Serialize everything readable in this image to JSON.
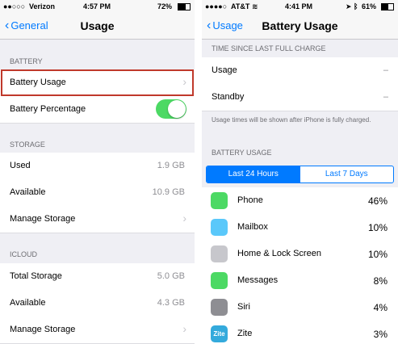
{
  "left": {
    "status": {
      "carrier": "Verizon",
      "time": "4:57 PM",
      "battery": "72%"
    },
    "nav": {
      "back": "General",
      "title": "Usage"
    },
    "battery_header": "BATTERY",
    "battery_usage": "Battery Usage",
    "battery_percentage": "Battery Percentage",
    "storage_header": "STORAGE",
    "used": {
      "label": "Used",
      "value": "1.9 GB"
    },
    "available": {
      "label": "Available",
      "value": "10.9 GB"
    },
    "manage": "Manage Storage",
    "icloud_header": "ICLOUD",
    "total": {
      "label": "Total Storage",
      "value": "5.0 GB"
    },
    "icloud_available": {
      "label": "Available",
      "value": "4.3 GB"
    },
    "icloud_manage": "Manage Storage"
  },
  "right": {
    "status": {
      "carrier": "AT&T",
      "time": "4:41 PM",
      "battery": "61%"
    },
    "nav": {
      "back": "Usage",
      "title": "Battery Usage"
    },
    "since_header": "TIME SINCE LAST FULL CHARGE",
    "usage": {
      "label": "Usage",
      "value": "–"
    },
    "standby": {
      "label": "Standby",
      "value": "–"
    },
    "note": "Usage times will be shown after iPhone is fully charged.",
    "battery_usage_header": "BATTERY USAGE",
    "segments": [
      "Last 24 Hours",
      "Last 7 Days"
    ],
    "apps": [
      {
        "name": "Phone",
        "pct": "46%",
        "color": "#4cd964",
        "icon": "phone-icon"
      },
      {
        "name": "Mailbox",
        "pct": "10%",
        "color": "#5ac8fa",
        "icon": "mailbox-icon"
      },
      {
        "name": "Home & Lock Screen",
        "pct": "10%",
        "color": "#c7c7cc",
        "icon": "home-lock-icon"
      },
      {
        "name": "Messages",
        "pct": "8%",
        "color": "#4cd964",
        "icon": "messages-icon"
      },
      {
        "name": "Siri",
        "pct": "4%",
        "color": "#8e8e93",
        "icon": "siri-icon"
      },
      {
        "name": "Zite",
        "pct": "3%",
        "color": "#34aadc",
        "icon": "zite-icon",
        "icon_text": "Zite"
      }
    ]
  }
}
